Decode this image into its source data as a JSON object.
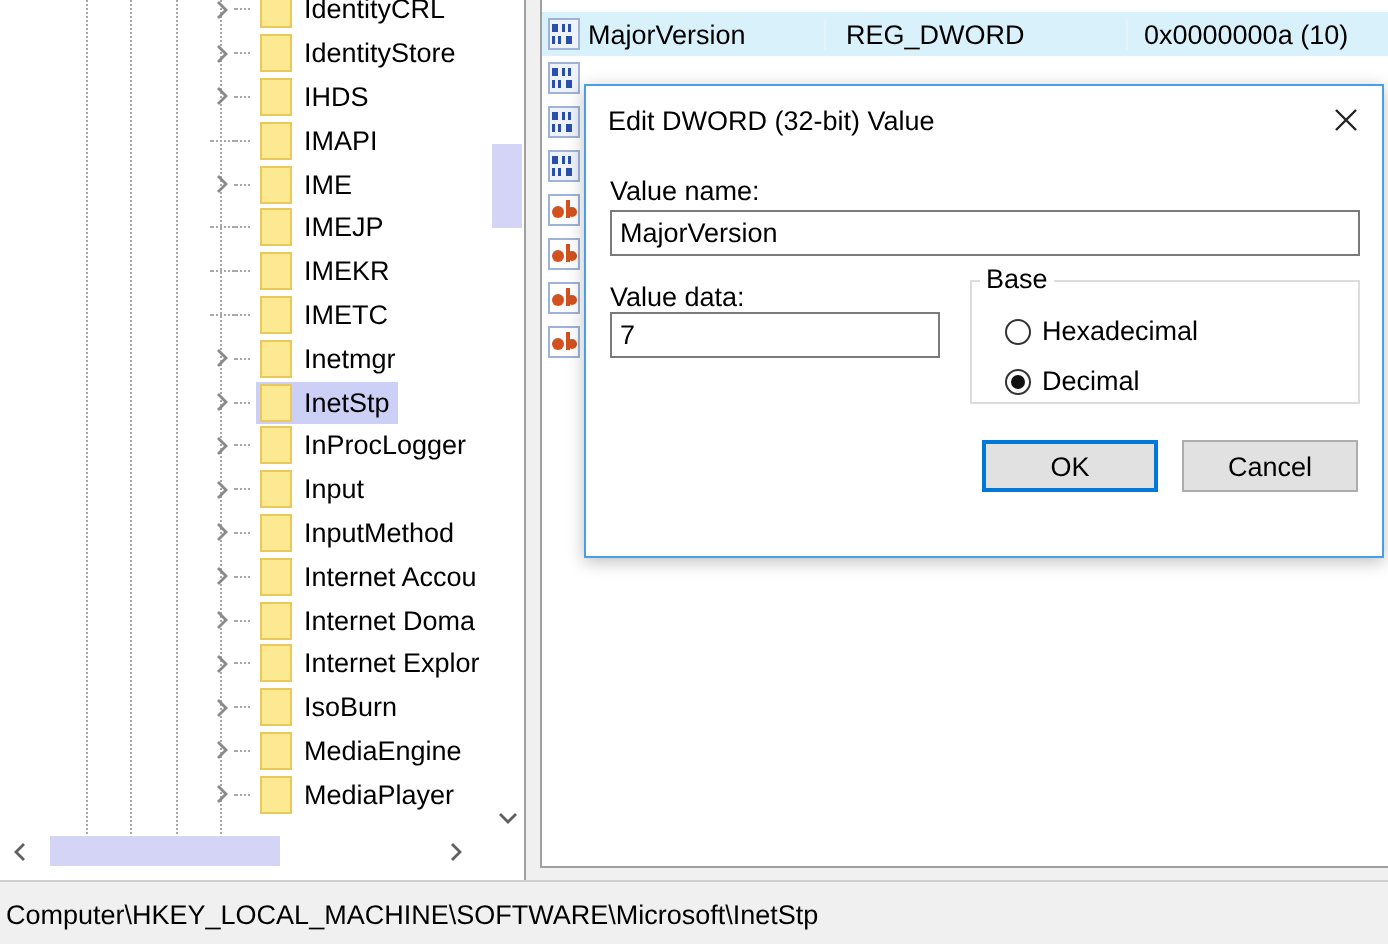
{
  "tree": {
    "items": [
      {
        "label": "IdentityCRL",
        "expandable": true,
        "selected": false
      },
      {
        "label": "IdentityStore",
        "expandable": true,
        "selected": false
      },
      {
        "label": "IHDS",
        "expandable": true,
        "selected": false
      },
      {
        "label": "IMAPI",
        "expandable": false,
        "selected": false
      },
      {
        "label": "IME",
        "expandable": true,
        "selected": false
      },
      {
        "label": "IMEJP",
        "expandable": false,
        "selected": false
      },
      {
        "label": "IMEKR",
        "expandable": false,
        "selected": false
      },
      {
        "label": "IMETC",
        "expandable": false,
        "selected": false
      },
      {
        "label": "Inetmgr",
        "expandable": true,
        "selected": false
      },
      {
        "label": "InetStp",
        "expandable": true,
        "selected": true
      },
      {
        "label": "InProcLogger",
        "expandable": true,
        "selected": false
      },
      {
        "label": "Input",
        "expandable": true,
        "selected": false
      },
      {
        "label": "InputMethod",
        "expandable": true,
        "selected": false
      },
      {
        "label": "Internet Accou",
        "expandable": true,
        "selected": false
      },
      {
        "label": "Internet Doma",
        "expandable": true,
        "selected": false
      },
      {
        "label": "Internet Explor",
        "expandable": true,
        "selected": false
      },
      {
        "label": "IsoBurn",
        "expandable": true,
        "selected": false
      },
      {
        "label": "MediaEngine",
        "expandable": true,
        "selected": false
      },
      {
        "label": "MediaPlayer",
        "expandable": true,
        "selected": false
      }
    ]
  },
  "values": {
    "rows": [
      {
        "kind": "dword",
        "name": "MajorVersion",
        "type": "REG_DWORD",
        "data": "0x0000000a (10)",
        "selected": true
      },
      {
        "kind": "dword",
        "selected": false
      },
      {
        "kind": "dword",
        "selected": false
      },
      {
        "kind": "dword",
        "selected": false
      },
      {
        "kind": "string",
        "selected": false
      },
      {
        "kind": "string",
        "selected": false
      },
      {
        "kind": "string",
        "selected": false
      },
      {
        "kind": "string",
        "selected": false
      }
    ]
  },
  "dialog": {
    "title": "Edit DWORD (32-bit) Value",
    "value_name_label": "Value name:",
    "value_name": "MajorVersion",
    "value_data_label": "Value data:",
    "value_data": "7",
    "base_label": "Base",
    "base_options": [
      {
        "label": "Hexadecimal",
        "selected": false
      },
      {
        "label": "Decimal",
        "selected": true
      }
    ],
    "buttons": [
      {
        "label": "OK",
        "default": true
      },
      {
        "label": "Cancel",
        "default": false
      }
    ]
  },
  "status_bar": {
    "path": "Computer\\HKEY_LOCAL_MACHINE\\SOFTWARE\\Microsoft\\InetStp"
  }
}
